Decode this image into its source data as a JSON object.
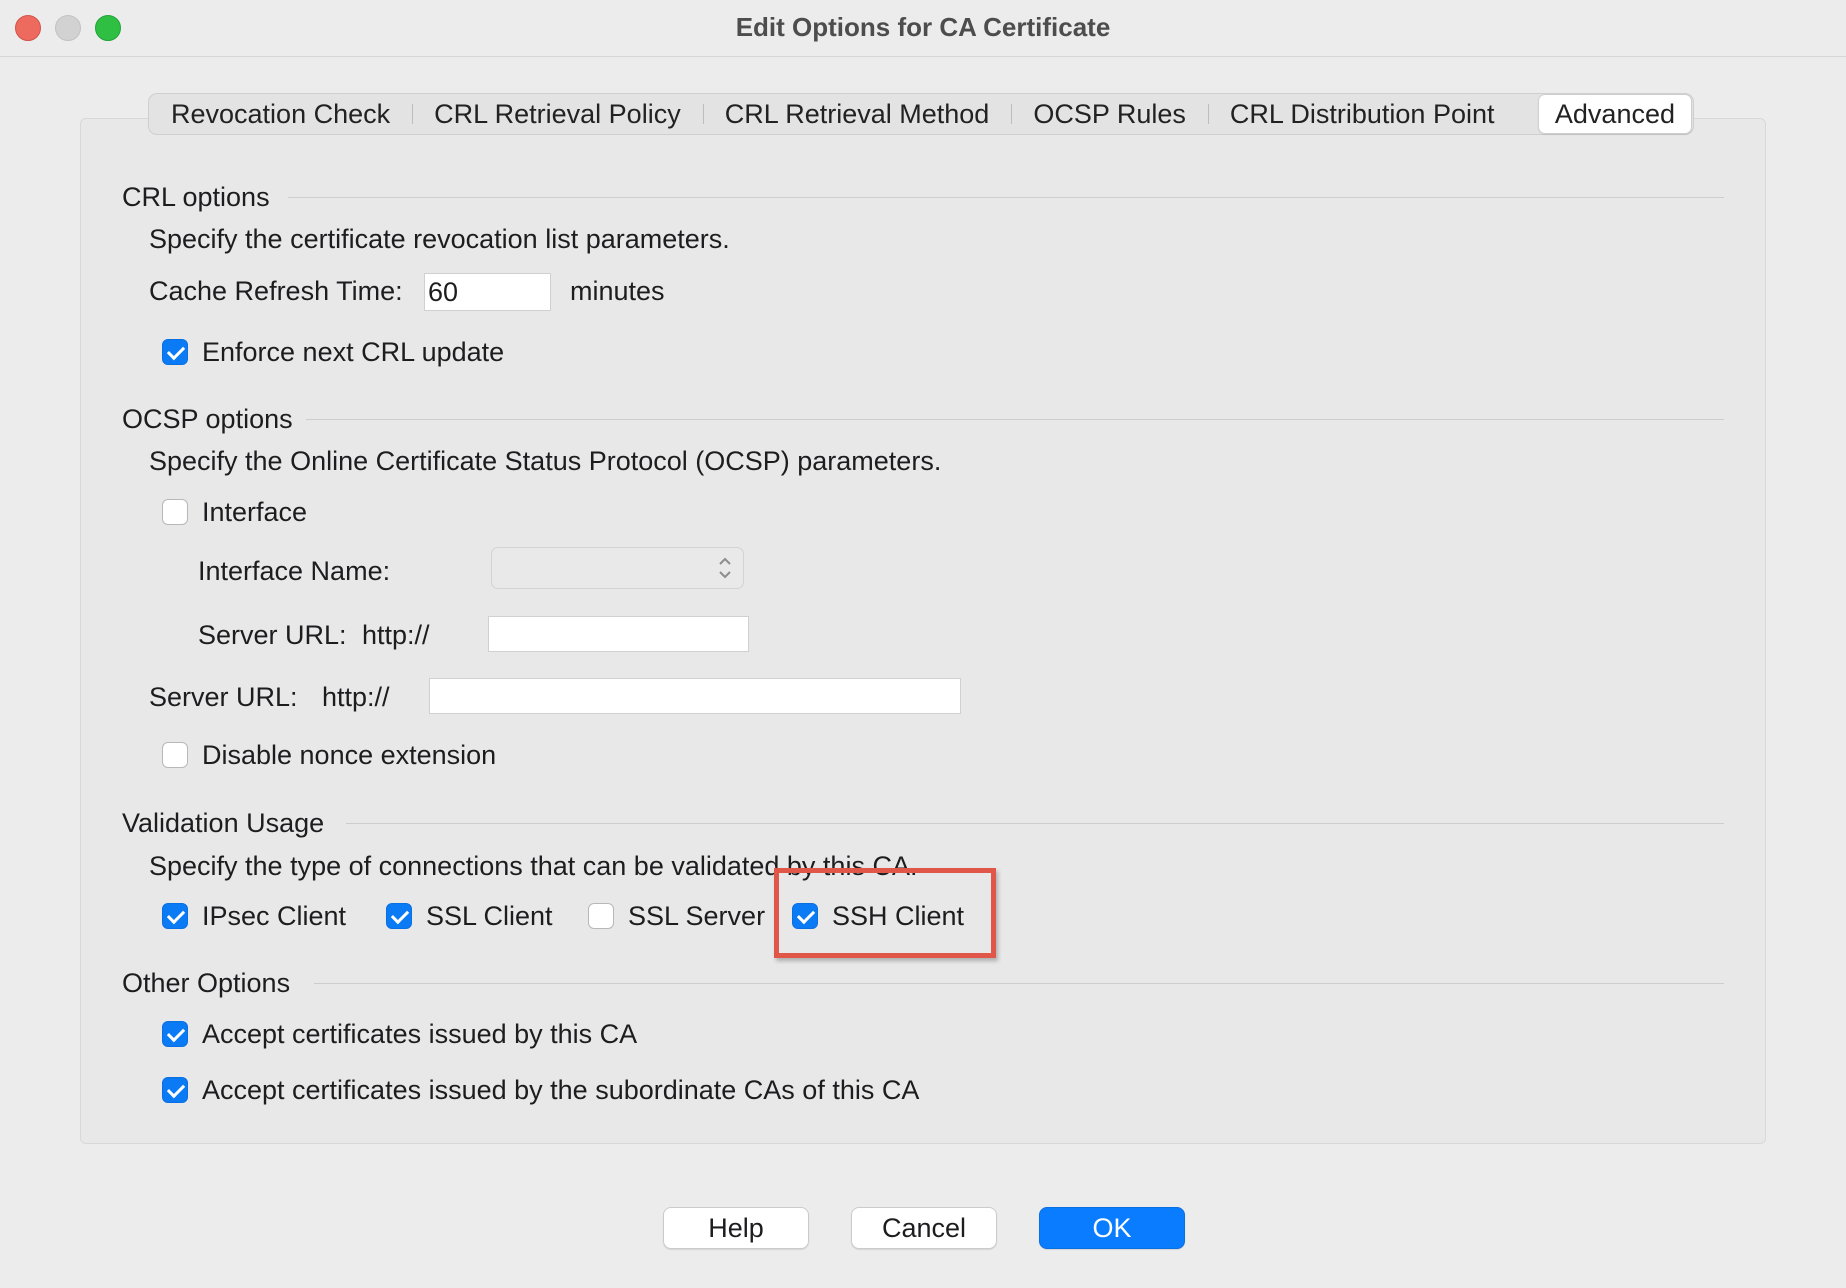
{
  "window": {
    "title": "Edit Options for CA Certificate"
  },
  "tabs": [
    {
      "label": "Revocation Check",
      "active": false
    },
    {
      "label": "CRL Retrieval Policy",
      "active": false
    },
    {
      "label": "CRL Retrieval Method",
      "active": false
    },
    {
      "label": "OCSP Rules",
      "active": false
    },
    {
      "label": "CRL Distribution Point",
      "active": false
    },
    {
      "label": "Advanced",
      "active": true
    }
  ],
  "crl": {
    "title": "CRL options",
    "description": "Specify the certificate revocation list parameters.",
    "cache_label": "Cache Refresh Time:",
    "cache_value": "60",
    "cache_unit": "minutes",
    "enforce_label": "Enforce next CRL update",
    "enforce_checked": true
  },
  "ocsp": {
    "title": "OCSP options",
    "description": "Specify the Online Certificate Status Protocol (OCSP)  parameters.",
    "interface_label": "Interface",
    "interface_checked": false,
    "interface_name_label": "Interface Name:",
    "interface_name_value": "",
    "iface_server_url_label": "Server URL:",
    "iface_server_url_prefix": "http://",
    "iface_server_url_value": "",
    "server_url_label": "Server URL:",
    "server_url_prefix": "http://",
    "server_url_value": "",
    "disable_nonce_label": "Disable nonce extension",
    "disable_nonce_checked": false
  },
  "validation": {
    "title": "Validation Usage",
    "description": "Specify the type of connections that can be validated by this CA.",
    "options": [
      {
        "label": "IPsec Client",
        "checked": true
      },
      {
        "label": "SSL Client",
        "checked": true
      },
      {
        "label": "SSL Server",
        "checked": false
      },
      {
        "label": "SSH Client",
        "checked": true
      }
    ],
    "highlight_color": "#e0574a"
  },
  "other": {
    "title": "Other Options",
    "accept_ca_label": "Accept certificates issued by this CA",
    "accept_ca_checked": true,
    "accept_sub_label": "Accept certificates issued by the subordinate CAs of this CA",
    "accept_sub_checked": true
  },
  "buttons": {
    "help": "Help",
    "cancel": "Cancel",
    "ok": "OK"
  },
  "colors": {
    "accent": "#0a7cff",
    "checkbox": "#0b7bf5",
    "close": "#ed6a5e",
    "maximize": "#2ebf43"
  }
}
